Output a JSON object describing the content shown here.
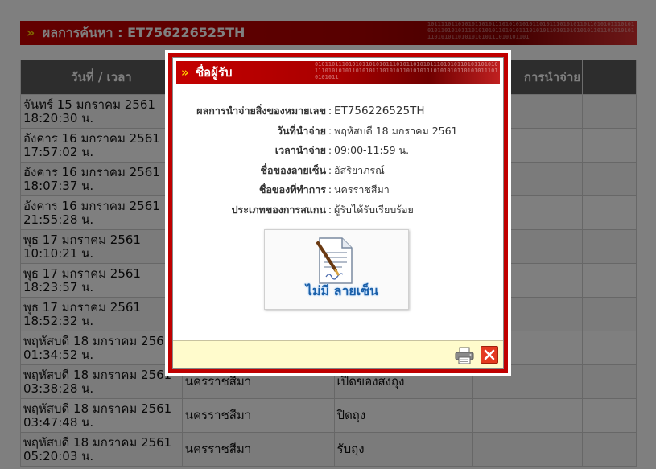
{
  "background": {
    "result_bar": {
      "chevrons": "»",
      "title": "ผลการค้นหา : ET756226525TH",
      "binary": "10111101101010110101110101010101101011101010110110101011101010101101010111010101011010101110101011010101010101101101010101110101011010101010111010101101"
    },
    "table": {
      "headers": [
        "วันที่ / เวลา",
        "",
        "",
        "การนำจ่าย",
        ""
      ],
      "rows": [
        [
          "จันทร์ 15 มกราคม 2561 18:20:30 น.",
          "",
          "",
          "",
          ""
        ],
        [
          "อังคาร 16 มกราคม 2561 17:57:02 น.",
          "",
          "",
          "",
          ""
        ],
        [
          "อังคาร 16 มกราคม 2561 18:07:37 น.",
          "",
          "",
          "",
          ""
        ],
        [
          "อังคาร 16 มกราคม 2561 21:55:28 น.",
          "",
          "",
          "",
          ""
        ],
        [
          "พุธ 17 มกราคม 2561 10:10:21 น.",
          "",
          "",
          "",
          ""
        ],
        [
          "พุธ 17 มกราคม 2561 18:23:57 น.",
          "",
          "",
          "",
          ""
        ],
        [
          "พุธ 17 มกราคม 2561 18:52:32 น.",
          "",
          "",
          "",
          ""
        ],
        [
          "พฤหัสบดี 18 มกราคม 2561 01:34:52 น.",
          "",
          "",
          "",
          ""
        ],
        [
          "พฤหัสบดี 18 มกราคม 2561 03:38:28 น.",
          "นครราชสีมา",
          "เปิดของสงถุง",
          "",
          ""
        ],
        [
          "พฤหัสบดี 18 มกราคม 2561 03:47:48 น.",
          "นครราชสีมา",
          "ปิดถุง",
          "",
          ""
        ],
        [
          "พฤหัสบดี 18 มกราคม 2561 05:20:03 น.",
          "นครราชสีมา",
          "รับถุง",
          "",
          ""
        ]
      ]
    }
  },
  "modal": {
    "header": {
      "chevrons": "»",
      "title": "ชื่อผู้รับ",
      "binary": "0101101110101011010101110101101010111010101101011010101110101010110101011101010110101011101010101101010111010101011"
    },
    "info": [
      {
        "label": "ผลการนำจ่ายสิ่งของหมายเลข",
        "sep": ":",
        "value": "ET756226525TH"
      },
      {
        "label": "วันที่นำจ่าย",
        "sep": ":",
        "value": "พฤหัสบดี 18 มกราคม 2561"
      },
      {
        "label": "เวลานำจ่าย",
        "sep": ":",
        "value": "09:00-11:59 น."
      },
      {
        "label": "ชื่อของลายเซ็น",
        "sep": ":",
        "value": "อัสริยาภรณ์"
      },
      {
        "label": "ชื่อของที่ทำการ",
        "sep": ":",
        "value": "นครราชสีมา"
      },
      {
        "label": "ประเภทของการสแกน",
        "sep": ":",
        "value": "ผู้รับได้รับเรียบร้อย"
      }
    ],
    "signature": {
      "icon": "no-signature-document-icon",
      "text": "ไม่มี ลายเซ็น"
    },
    "footer": {
      "print_icon": "printer-icon",
      "close_icon": "close-icon"
    }
  },
  "colors": {
    "accent_red": "#c00000",
    "chevron_yellow": "#ffcc00",
    "footer_yellow": "#fffbcc",
    "header_gray": "#5a5a5a",
    "close_red": "#e43a1f",
    "signature_blue": "#1a5fa8"
  }
}
